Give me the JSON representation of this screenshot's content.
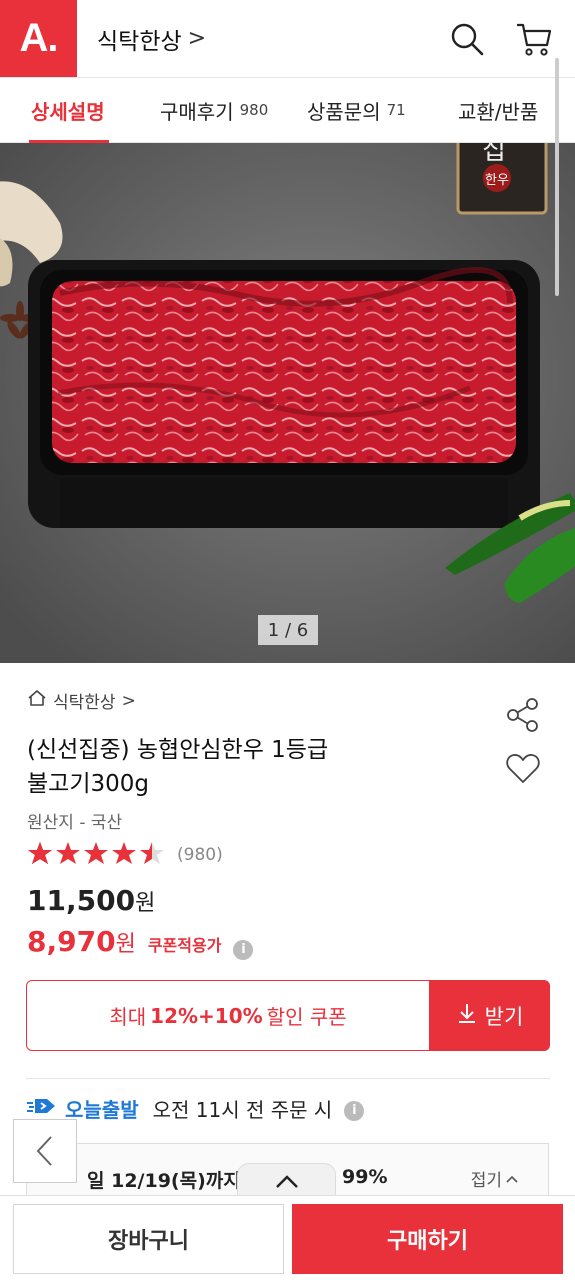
{
  "header": {
    "logo": "A.",
    "store_name": "식탁한상",
    "store_chevron": ">"
  },
  "tabs": [
    {
      "label": "상세설명",
      "count": ""
    },
    {
      "label": "구매후기",
      "count": "980"
    },
    {
      "label": "상품문의",
      "count": "71"
    },
    {
      "label": "교환/반품",
      "count": ""
    }
  ],
  "gallery": {
    "counter": "1 / 6",
    "box_text_1": "집",
    "box_text_2": "한우"
  },
  "product": {
    "breadcrumb": "식탁한상",
    "breadcrumb_chevron": ">",
    "title_line1": "(신선집중) 농협안심한우 1등급",
    "title_line2": "불고기300g",
    "origin": "원산지 - 국산",
    "rating": 4.5,
    "review_count": "(980)",
    "price_number": "11,500",
    "price_unit": "원",
    "coupon_price_number": "8,970",
    "coupon_price_unit": "원",
    "coupon_price_label": "쿠폰적용가",
    "info_icon": "i"
  },
  "coupon": {
    "prefix": "최대",
    "highlight": "12%+10%",
    "suffix": "할인 쿠폰",
    "get_label": "받기"
  },
  "shipping": {
    "today_label": "오늘출발",
    "detail": "오전 11시 전 주문 시",
    "delivery_text": "일 12/19(목)까지",
    "delivery_pct": "99%",
    "fold_label": "접기"
  },
  "bottom": {
    "cart_label": "장바구니",
    "buy_label": "구매하기"
  },
  "colors": {
    "accent": "#e8313b",
    "today_blue": "#1f7ad6"
  }
}
